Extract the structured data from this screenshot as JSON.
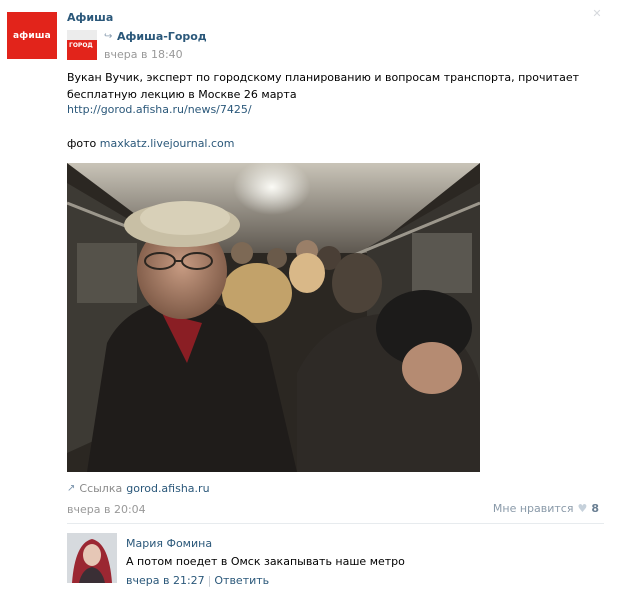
{
  "post": {
    "author": {
      "name": "Афиша",
      "avatar_text": "афиша",
      "avatar_color": "#e2241b"
    },
    "repost": {
      "avatar_text": "ГОРОД",
      "icon": "repost-arrow-icon",
      "name": "Афиша-Город",
      "time": "вчера в 18:40"
    },
    "text": "Вукан Вучик, эксперт по городскому планированию и вопросам транспорта, прочитает бесплатную лекцию в Москве 26 марта",
    "link": "http://gorod.afisha.ru/news/7425/",
    "photo_credit": {
      "prefix": "фото",
      "link": "maxkatz.livejournal.com"
    },
    "attachment": {
      "icon": "share-arrow-icon",
      "label": "Ссылка",
      "domain": "gorod.afisha.ru"
    },
    "time": "вчера в 20:04",
    "likes": {
      "label": "Мне нравится",
      "icon": "heart-icon",
      "count": "8"
    },
    "close_icon": "close-icon"
  },
  "comment": {
    "author": "Мария Фомина",
    "text": "А потом поедет в Омск закапывать наше метро",
    "time": "вчера в 21:27",
    "reply_label": "Ответить"
  },
  "colors": {
    "link": "#2b587a",
    "brand_red": "#e2241b",
    "muted": "#999999"
  }
}
